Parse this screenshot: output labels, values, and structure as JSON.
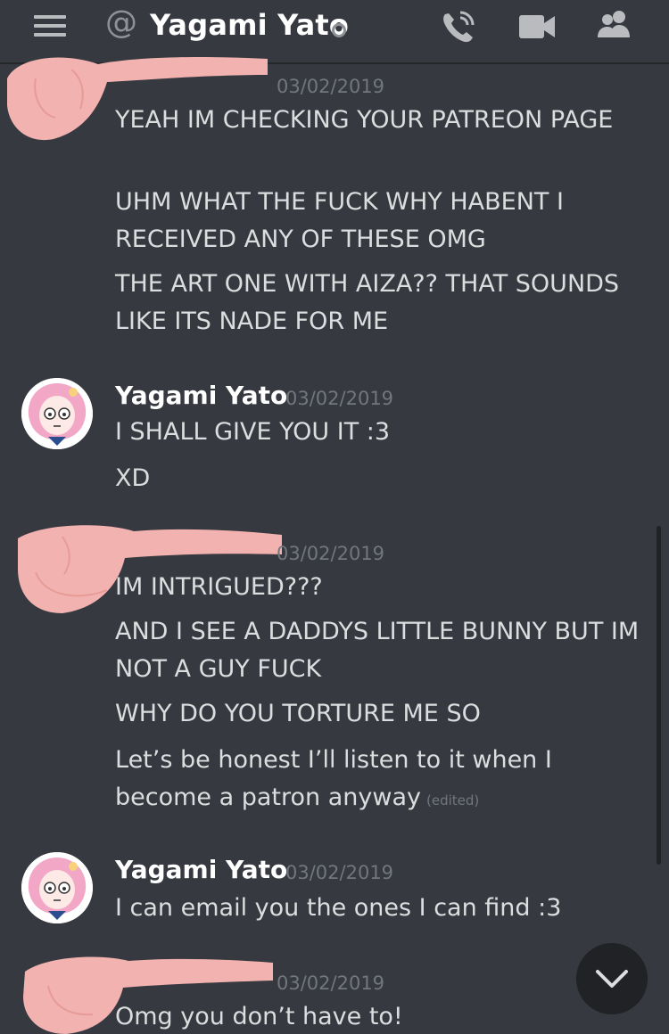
{
  "header": {
    "at_symbol": "@",
    "title": "Yagami Yato",
    "icons": [
      "menu-icon",
      "at-icon",
      "status-offline-icon",
      "call-icon",
      "video-icon",
      "members-icon"
    ]
  },
  "messages": [
    {
      "author": "",
      "timestamp": "03/02/2019",
      "lines": [
        "YEAH IM CHECKING YOUR PATREON PAGE",
        "UHM WHAT THE FUCK WHY HABENT I RECEIVED ANY OF THESE OMG",
        "THE ART ONE WITH AIZA?? THAT SOUNDS LIKE ITS NADE FOR ME"
      ]
    },
    {
      "author": "Yagami Yato",
      "timestamp": "03/02/2019",
      "lines": [
        "I SHALL GIVE YOU IT :3",
        "XD"
      ]
    },
    {
      "author": "",
      "timestamp": "03/02/2019",
      "lines": [
        "IM INTRIGUED???",
        "AND I SEE A DADDYS LITTLE BUNNY BUT IM NOT A GUY FUCK",
        "WHY DO YOU TORTURE ME SO",
        "Let’s be honest I’ll listen to it when I become a patron anyway"
      ],
      "edited_label": "(edited)"
    },
    {
      "author": "Yagami Yato",
      "timestamp": "03/02/2019",
      "lines": [
        "I can email you the ones I can find :3"
      ]
    },
    {
      "author": "",
      "timestamp": "03/02/2019",
      "lines": [
        "Omg you don’t have to!"
      ]
    }
  ],
  "colors": {
    "background": "#36393f",
    "text": "#dcddde",
    "muted": "#72767d",
    "redaction": "#f2b2b0"
  }
}
